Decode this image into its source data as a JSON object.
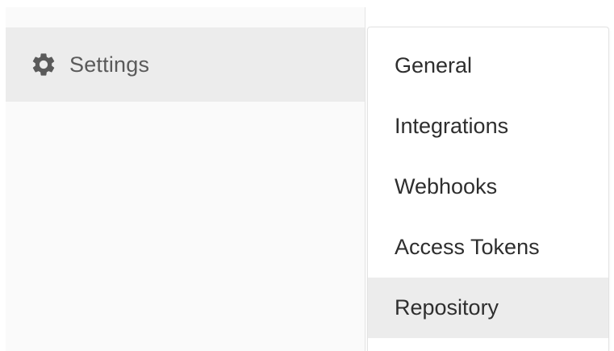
{
  "sidebar": {
    "item": {
      "label": "Settings",
      "icon": "gear-icon"
    }
  },
  "flyout": {
    "items": [
      {
        "label": "General"
      },
      {
        "label": "Integrations"
      },
      {
        "label": "Webhooks"
      },
      {
        "label": "Access Tokens"
      },
      {
        "label": "Repository",
        "active": true
      }
    ]
  },
  "colors": {
    "sidebar_bg": "#fafafa",
    "highlight_bg": "#ececec",
    "icon_color": "#5a5a5a",
    "text_color": "#2e2e2e"
  }
}
